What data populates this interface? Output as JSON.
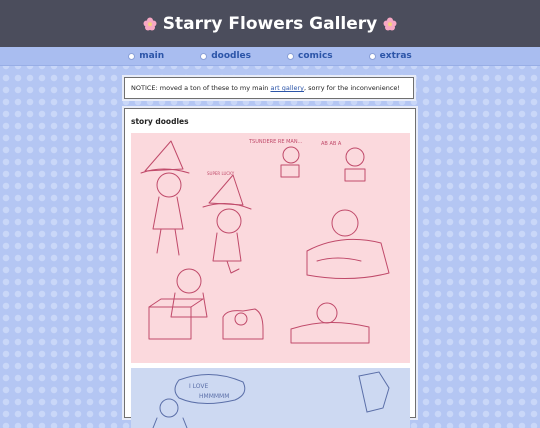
{
  "header": {
    "title": "Starry Flowers Gallery",
    "left_icon": "flower-icon",
    "right_icon": "flower-icon"
  },
  "nav": {
    "items": [
      {
        "label": "main"
      },
      {
        "label": "doodles"
      },
      {
        "label": "comics"
      },
      {
        "label": "extras"
      }
    ]
  },
  "notice": {
    "prefix": "NOTICE: moved a ton of these to my main ",
    "link": "art gallery",
    "suffix": ", sorry for the inconvenience!"
  },
  "section": {
    "title": "story doodles"
  },
  "artwork": {
    "sketch1_text": "TSUNDERE RE MAN...",
    "sketch1_ab": "AB AB A",
    "sketch1_small": "SUPER LUCKY",
    "sketch2_text1": "I LOVE",
    "sketch2_text2": "HMMMMM"
  },
  "colors": {
    "header_bg": "#4b4d5c",
    "nav_bg": "#a9bdf0",
    "link": "#2c55a8",
    "page_bg": "#b4c6f3"
  }
}
